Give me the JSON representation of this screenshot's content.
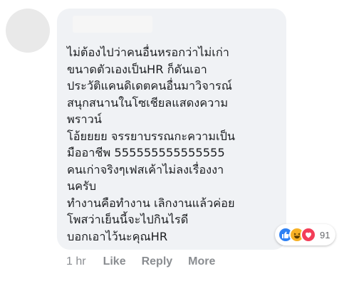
{
  "comment": {
    "text": "ไม่ต้องไปว่าคนอื่นหรอกว่าไม่เก่า\nขนาดตัวเองเป็นHR ก็ดันเอา\nประวัติแคนดิเดตคนอื่นมาวิจารณ์\nสนุกสนานในโซเชียลแสดงความ\nพราวน์\nโอ้ยยยย จรรยาบรรณกะความเป็น\nมืออาชีพ 555555555555555\nคนเก่าจริงๆเฟสเค้าไม่ลงเรื่องงา\nนครับ\nทำงานคือทำงาน เลิกงานแล้วค่อย\nโพสว่าเย็นนี้จะไปกินไรดี\nบอกเอาไว้นะคุณHR"
  },
  "reactions": {
    "icons": [
      "like-icon",
      "haha-icon",
      "love-icon"
    ],
    "count": "91",
    "colors": {
      "like": "#2e81f4",
      "haha": "#f7b125",
      "love": "#f33e58"
    }
  },
  "actions": {
    "time": "1 hr",
    "like": "Like",
    "reply": "Reply",
    "more": "More"
  }
}
